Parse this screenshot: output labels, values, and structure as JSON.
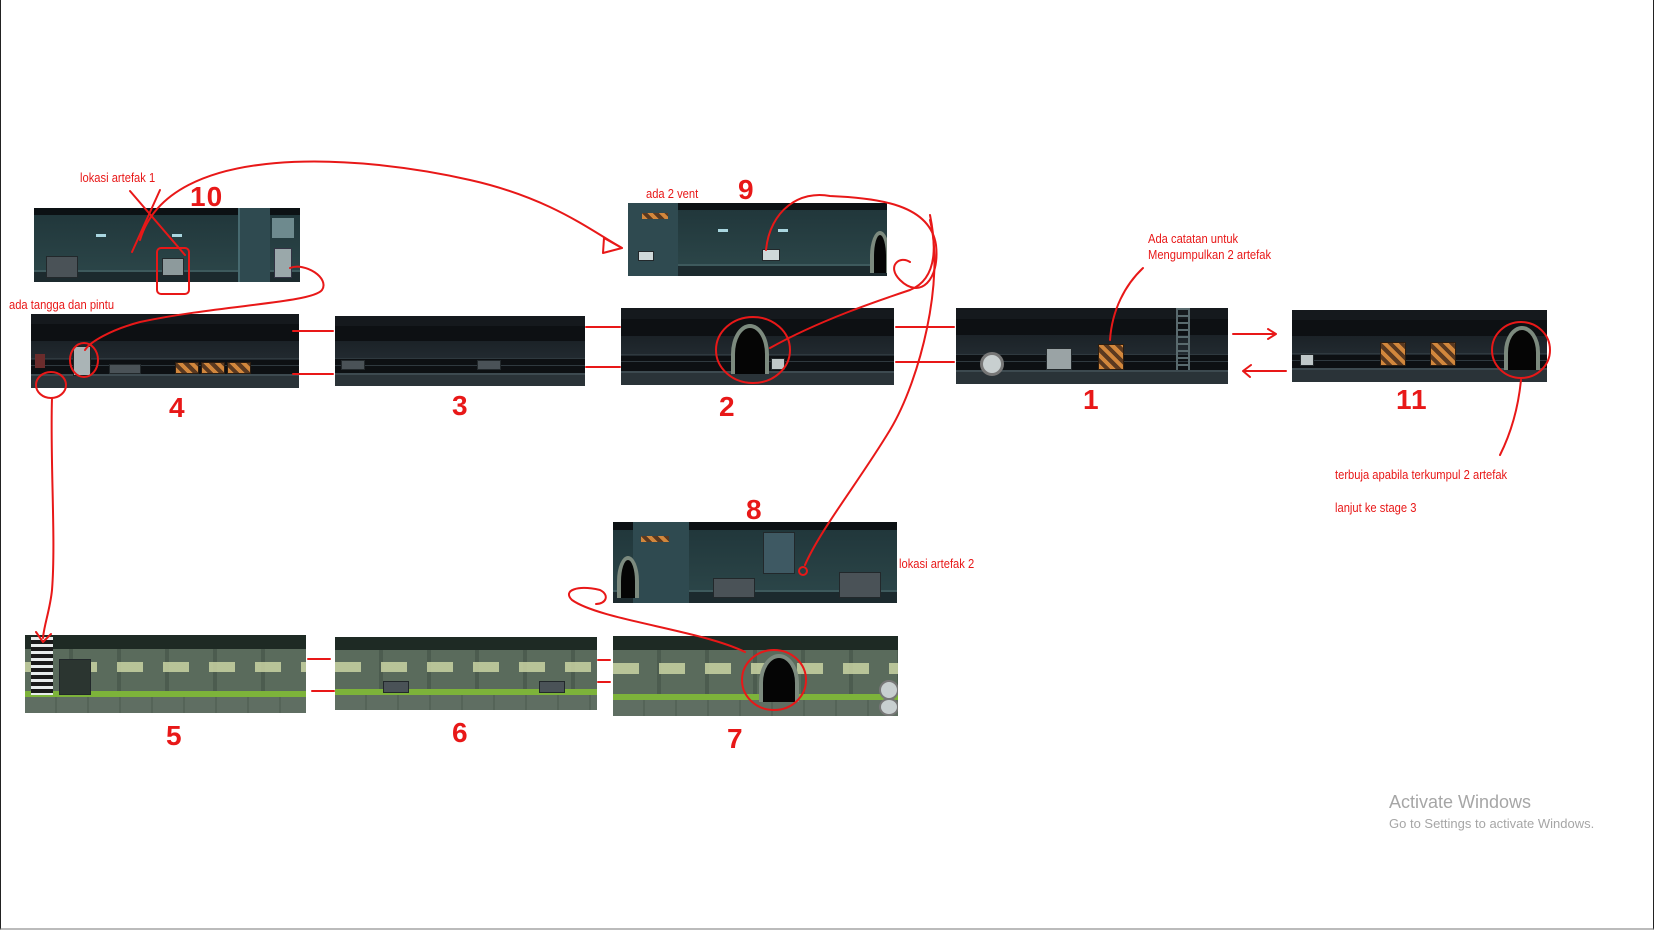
{
  "rooms": [
    {
      "id": "1",
      "label": "1"
    },
    {
      "id": "2",
      "label": "2"
    },
    {
      "id": "3",
      "label": "3"
    },
    {
      "id": "4",
      "label": "4"
    },
    {
      "id": "5",
      "label": "5"
    },
    {
      "id": "6",
      "label": "6"
    },
    {
      "id": "7",
      "label": "7"
    },
    {
      "id": "8",
      "label": "8"
    },
    {
      "id": "9",
      "label": "9"
    },
    {
      "id": "10",
      "label": "10"
    },
    {
      "id": "11",
      "label": "11"
    }
  ],
  "notes": {
    "artifact_1": "lokasi artefak 1",
    "stairs_door": "ada tangga dan pintu",
    "vents": "ada 2 vent",
    "note_line1": "Ada catatan untuk",
    "note_line2": "Mengumpulkan 2 artefak",
    "artifact_2": "lokasi artefak 2",
    "opens_when": "terbuja apabila terkumpul 2 artefak",
    "next_stage": "lanjut ke stage 3"
  },
  "watermark": {
    "title": "Activate Windows",
    "subtitle": "Go to Settings to activate Windows."
  },
  "colors": {
    "annotation": "#e81818",
    "background": "#ffffff"
  }
}
